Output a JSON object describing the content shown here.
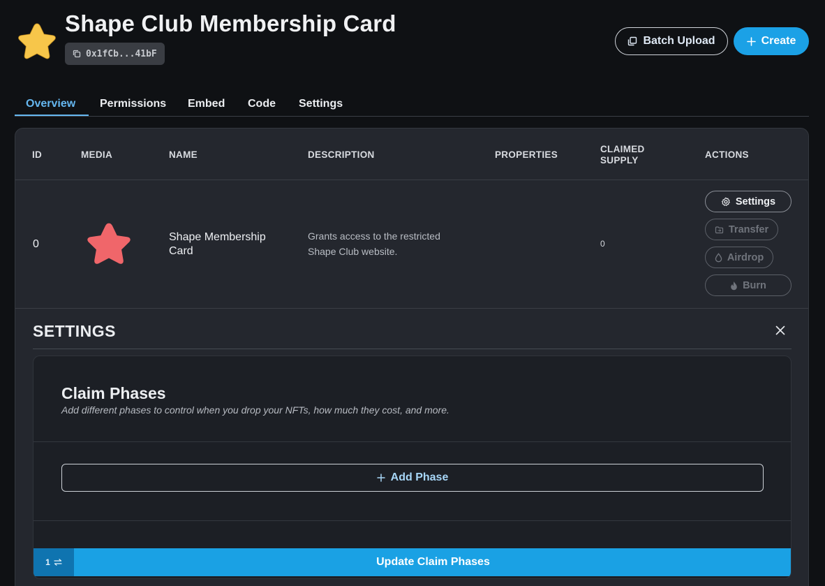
{
  "header": {
    "title": "Shape Club Membership Card",
    "address": "0x1fCb...41bF",
    "batch_upload_label": "Batch Upload",
    "create_label": "Create"
  },
  "tabs": [
    {
      "label": "Overview",
      "active": true
    },
    {
      "label": "Permissions"
    },
    {
      "label": "Embed"
    },
    {
      "label": "Code"
    },
    {
      "label": "Settings"
    }
  ],
  "table": {
    "columns": [
      "ID",
      "MEDIA",
      "NAME",
      "DESCRIPTION",
      "PROPERTIES",
      "CLAIMED SUPPLY",
      "ACTIONS"
    ],
    "rows": [
      {
        "id": "0",
        "media": "coral-star-image",
        "name": "Shape Membership Card",
        "description": "Grants access to the restricted Shape Club website.",
        "properties": "",
        "claimed_supply": "0"
      }
    ],
    "actions": [
      {
        "label": "Settings",
        "icon": "gear-icon",
        "enabled": true
      },
      {
        "label": "Transfer",
        "icon": "transfer-icon",
        "enabled": false
      },
      {
        "label": "Airdrop",
        "icon": "droplet-icon",
        "enabled": false
      },
      {
        "label": "Burn",
        "icon": "flame-icon",
        "enabled": false
      }
    ]
  },
  "settings": {
    "title": "SETTINGS",
    "claim_phases": {
      "title": "Claim Phases",
      "subtitle": "Add different phases to control when you drop your NFTs, how much they cost, and more.",
      "add_phase_label": "Add Phase",
      "pending_count": "1",
      "update_label": "Update Claim Phases"
    }
  },
  "colors": {
    "background": "#0f1114",
    "panel": "#24272e",
    "accent": "#1ba1e6",
    "tab_active": "#65b7f0",
    "logo_star": "#f7c64a",
    "media_star": "#f0666a"
  }
}
